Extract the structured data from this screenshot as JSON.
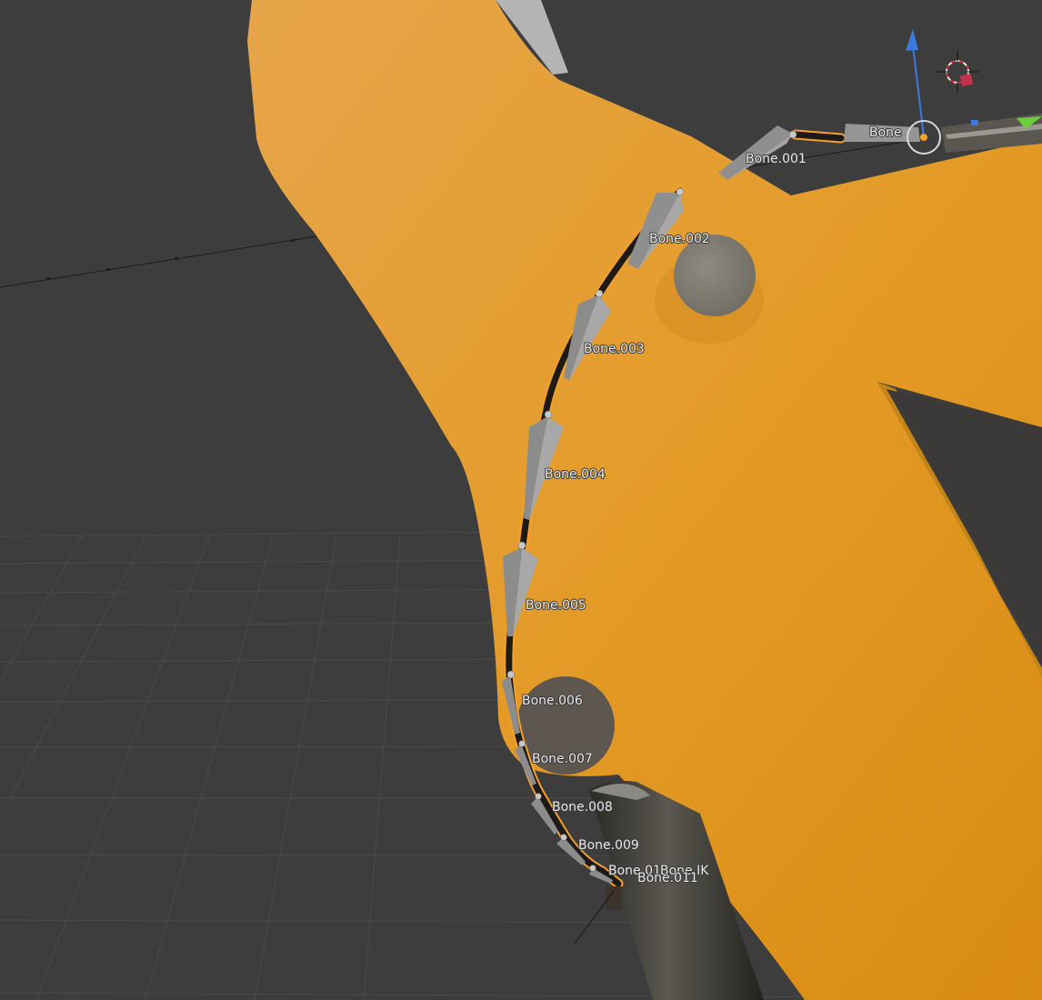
{
  "viewport": {
    "background": "#3d3d3d",
    "grid_color": "#4a4a4a",
    "mesh_color": "#e1951f",
    "bone_color": "#8c8c8c",
    "selection_color": "#f5a12b",
    "gizmo_z_color": "#3b7be0",
    "gizmo_y_color": "#6fcf3a"
  },
  "bones": [
    {
      "name": "Bone"
    },
    {
      "name": "Bone.001"
    },
    {
      "name": "Bone.002"
    },
    {
      "name": "Bone.003"
    },
    {
      "name": "Bone.004"
    },
    {
      "name": "Bone.005"
    },
    {
      "name": "Bone.006"
    },
    {
      "name": "Bone.007"
    },
    {
      "name": "Bone.008"
    },
    {
      "name": "Bone.009"
    },
    {
      "name": "Bone.01"
    },
    {
      "name": "Bone.IK"
    },
    {
      "name": "Bone.011"
    }
  ],
  "icons": {
    "cursor": "3d-cursor-icon",
    "light": "light-icon",
    "transform": "transform-gizmo-icon"
  }
}
